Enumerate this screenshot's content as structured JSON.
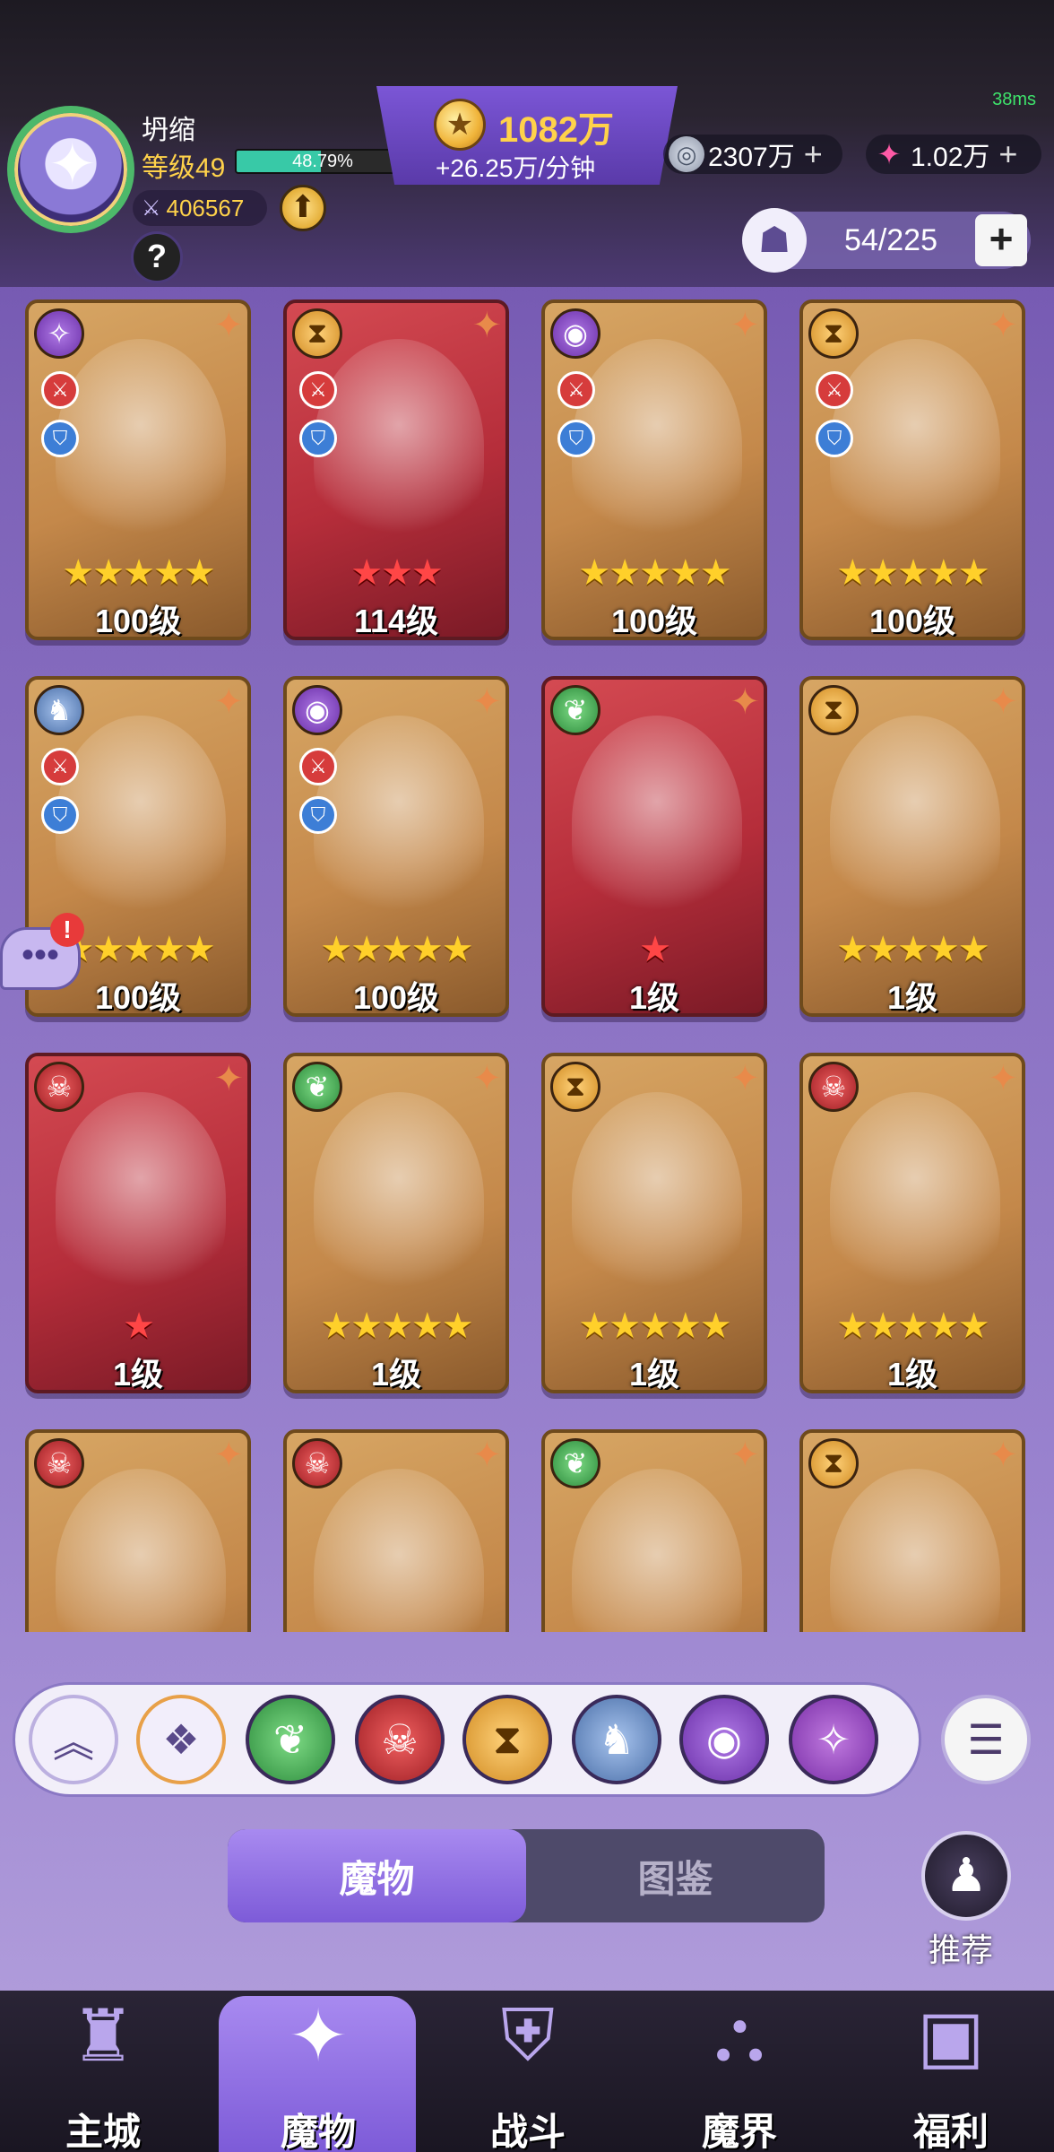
{
  "status": {
    "ping": "38ms"
  },
  "player": {
    "name": "坍缩",
    "level": "等级49",
    "xp_percent": "48.79%",
    "xp_fraction": 0.4879,
    "power": "406567"
  },
  "currency": {
    "gold_amount": "1082万",
    "gold_rate": "+26.25万/分钟",
    "silver": "2307万",
    "gems": "1.02万"
  },
  "capacity": {
    "text": "54/225"
  },
  "cards": [
    {
      "faction": "chaos",
      "faction_glyph": "✧",
      "stars": "★★★★★",
      "star_color": "gold",
      "level": "100级",
      "bg": "gold"
    },
    {
      "faction": "sand",
      "faction_glyph": "⧗",
      "stars": "★★★",
      "star_color": "red",
      "level": "114级",
      "bg": "red"
    },
    {
      "faction": "eye",
      "faction_glyph": "◉",
      "stars": "★★★★★",
      "star_color": "gold",
      "level": "100级",
      "bg": "gold"
    },
    {
      "faction": "sand",
      "faction_glyph": "⧗",
      "stars": "★★★★★",
      "star_color": "gold",
      "level": "100级",
      "bg": "gold"
    },
    {
      "faction": "dragon",
      "faction_glyph": "♞",
      "stars": "★★★★★",
      "star_color": "gold",
      "level": "100级",
      "bg": "gold"
    },
    {
      "faction": "eye",
      "faction_glyph": "◉",
      "stars": "★★★★★",
      "star_color": "gold",
      "level": "100级",
      "bg": "gold"
    },
    {
      "faction": "nature",
      "faction_glyph": "❦",
      "stars": "★",
      "star_color": "red",
      "level": "1级",
      "bg": "red"
    },
    {
      "faction": "sand",
      "faction_glyph": "⧗",
      "stars": "★★★★★",
      "star_color": "gold",
      "level": "1级",
      "bg": "gold"
    },
    {
      "faction": "fire",
      "faction_glyph": "☠",
      "stars": "★",
      "star_color": "red",
      "level": "1级",
      "bg": "red"
    },
    {
      "faction": "nature",
      "faction_glyph": "❦",
      "stars": "★★★★★",
      "star_color": "gold",
      "level": "1级",
      "bg": "gold"
    },
    {
      "faction": "sand",
      "faction_glyph": "⧗",
      "stars": "★★★★★",
      "star_color": "gold",
      "level": "1级",
      "bg": "gold"
    },
    {
      "faction": "fire",
      "faction_glyph": "☠",
      "stars": "★★★★★",
      "star_color": "gold",
      "level": "1级",
      "bg": "gold"
    },
    {
      "faction": "fire",
      "faction_glyph": "☠",
      "stars": "",
      "star_color": "gold",
      "level": "",
      "bg": "gold"
    },
    {
      "faction": "fire",
      "faction_glyph": "☠",
      "stars": "",
      "star_color": "gold",
      "level": "",
      "bg": "gold"
    },
    {
      "faction": "nature",
      "faction_glyph": "❦",
      "stars": "",
      "star_color": "gold",
      "level": "",
      "bg": "gold"
    },
    {
      "faction": "sand",
      "faction_glyph": "⧗",
      "stars": "",
      "star_color": "gold",
      "level": "",
      "bg": "gold"
    }
  ],
  "tabs": {
    "monsters": "魔物",
    "codex": "图鉴"
  },
  "recommend": {
    "label": "推荐"
  },
  "nav": [
    {
      "label": "主城",
      "icon": "castle-icon"
    },
    {
      "label": "魔物",
      "icon": "flame-star-icon"
    },
    {
      "label": "战斗",
      "icon": "shield-sword-icon"
    },
    {
      "label": "魔界",
      "icon": "portal-icon"
    },
    {
      "label": "福利",
      "icon": "chest-icon"
    }
  ]
}
